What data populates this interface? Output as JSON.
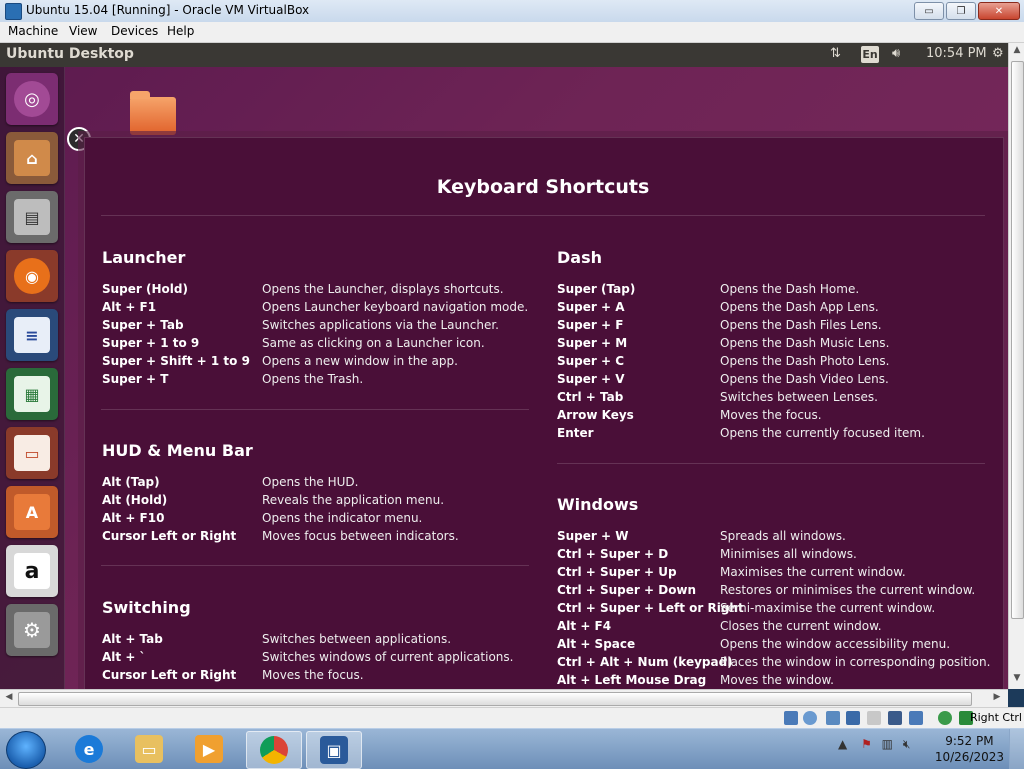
{
  "window": {
    "title": "Ubuntu 15.04 [Running] - Oracle VM VirtualBox",
    "minimize": "▭",
    "restore": "❐",
    "close": "✕"
  },
  "menu": [
    "Machine",
    "View",
    "Devices",
    "Help"
  ],
  "guest": {
    "panel_title": "Ubuntu Desktop",
    "keyboard_layout": "En",
    "time": "10:54 PM",
    "launcher_items": [
      "ubuntu-dash-icon",
      "system-installer-icon",
      "files-icon",
      "firefox-icon",
      "writer-icon",
      "calc-icon",
      "impress-icon",
      "software-center-icon",
      "amazon-icon",
      "system-settings-icon"
    ]
  },
  "shortcuts": {
    "title": "Keyboard Shortcuts",
    "launcher": {
      "heading": "Launcher",
      "rows": [
        {
          "key": "Super (Hold)",
          "desc": "Opens the Launcher, displays shortcuts."
        },
        {
          "key": "Alt + F1",
          "desc": "Opens Launcher keyboard navigation mode."
        },
        {
          "key": "Super + Tab",
          "desc": "Switches applications via the Launcher."
        },
        {
          "key": "Super + 1 to 9",
          "desc": "Same as clicking on a Launcher icon."
        },
        {
          "key": "Super + Shift + 1 to 9",
          "desc": "Opens a new window in the app."
        },
        {
          "key": "Super + T",
          "desc": "Opens the Trash."
        }
      ]
    },
    "hud": {
      "heading": "HUD & Menu Bar",
      "rows": [
        {
          "key": "Alt (Tap)",
          "desc": "Opens the HUD."
        },
        {
          "key": "Alt (Hold)",
          "desc": "Reveals the application menu."
        },
        {
          "key": "Alt + F10",
          "desc": "Opens the indicator menu."
        },
        {
          "key": "Cursor Left or Right",
          "desc": "Moves focus between indicators."
        }
      ]
    },
    "switching": {
      "heading": "Switching",
      "rows": [
        {
          "key": "Alt + Tab",
          "desc": "Switches between applications."
        },
        {
          "key": "Alt + `",
          "desc": "Switches windows of current applications."
        },
        {
          "key": "Cursor Left or Right",
          "desc": "Moves the focus."
        }
      ]
    },
    "dash": {
      "heading": "Dash",
      "rows": [
        {
          "key": "Super (Tap)",
          "desc": "Opens the Dash Home."
        },
        {
          "key": "Super + A",
          "desc": "Opens the Dash App Lens."
        },
        {
          "key": "Super + F",
          "desc": "Opens the Dash Files Lens."
        },
        {
          "key": "Super + M",
          "desc": "Opens the Dash Music Lens."
        },
        {
          "key": "Super + C",
          "desc": "Opens the Dash Photo Lens."
        },
        {
          "key": "Super + V",
          "desc": "Opens the Dash Video Lens."
        },
        {
          "key": "Ctrl + Tab",
          "desc": "Switches between Lenses."
        },
        {
          "key": "Arrow Keys",
          "desc": "Moves the focus."
        },
        {
          "key": "Enter",
          "desc": "Opens the currently focused item."
        }
      ]
    },
    "windows": {
      "heading": "Windows",
      "rows": [
        {
          "key": "Super + W",
          "desc": "Spreads all windows."
        },
        {
          "key": "Ctrl + Super + D",
          "desc": "Minimises all windows."
        },
        {
          "key": "Ctrl + Super + Up",
          "desc": "Maximises the current window."
        },
        {
          "key": "Ctrl + Super + Down",
          "desc": "Restores or minimises the current window."
        },
        {
          "key": "Ctrl + Super + Left or Right",
          "desc": "Semi-maximise the current window."
        },
        {
          "key": "Alt + F4",
          "desc": "Closes the current window."
        },
        {
          "key": "Alt + Space",
          "desc": "Opens the window accessibility menu."
        },
        {
          "key": "Ctrl + Alt + Num (keypad)",
          "desc": "Places the window in corresponding position."
        },
        {
          "key": "Alt + Left Mouse Drag",
          "desc": "Moves the window."
        }
      ]
    }
  },
  "status": {
    "host_key": "Right Ctrl"
  },
  "taskbar": {
    "time": "9:52 PM",
    "date": "10/26/2023",
    "apps": [
      "internet-explorer-icon",
      "explorer-icon",
      "media-player-icon",
      "chrome-icon",
      "virtualbox-icon"
    ]
  },
  "colors": {
    "overlay": "#4a0f38",
    "panel": "#3a3834",
    "desktop": "#6e2455"
  }
}
